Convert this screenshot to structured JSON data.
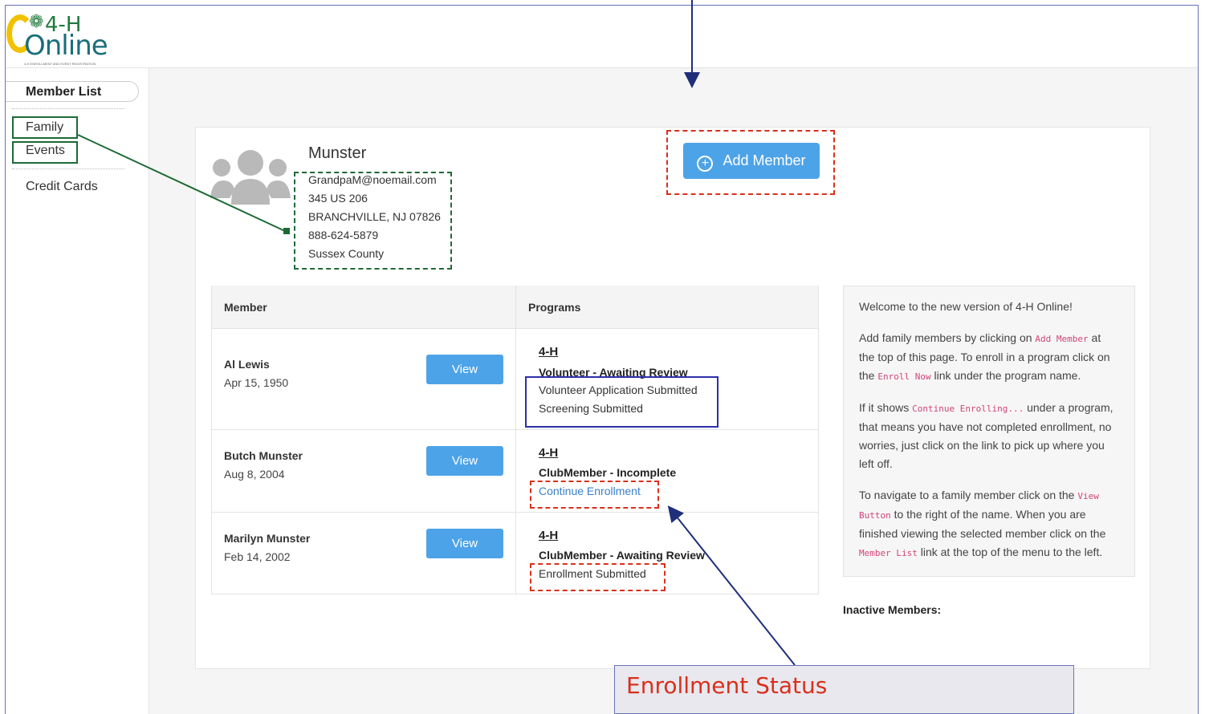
{
  "logo": {
    "brand_top": "4-H",
    "brand_bottom": "Online",
    "tagline": "4-H ENROLLMENT AND EVENT REGISTRATION"
  },
  "sidebar": {
    "items": [
      {
        "label": "Member List"
      },
      {
        "label": "Family"
      },
      {
        "label": "Events"
      },
      {
        "label": "Credit Cards"
      }
    ]
  },
  "family": {
    "name": "Munster",
    "email": "GrandpaM@noemail.com",
    "street": "345 US 206",
    "city": "BRANCHVILLE, NJ 07826",
    "phone": "888-624-5879",
    "county": "Sussex County"
  },
  "add_member_label": "Add Member",
  "table": {
    "headers": [
      "Member",
      "Programs"
    ],
    "view_label": "View",
    "rows": [
      {
        "name": "Al Lewis",
        "dob": "Apr 15, 1950",
        "program": "4-H",
        "role": "Volunteer - Awaiting Review",
        "status": [
          "Volunteer Application Submitted",
          "Screening Submitted"
        ]
      },
      {
        "name": "Butch Munster",
        "dob": "Aug 8, 2004",
        "program": "4-H",
        "role": "ClubMember - Incomplete",
        "status": [
          "Continue Enrollment"
        ]
      },
      {
        "name": "Marilyn Munster",
        "dob": "Feb 14, 2002",
        "program": "4-H",
        "role": "ClubMember - Awaiting Review",
        "status": [
          "Enrollment Submitted"
        ]
      }
    ]
  },
  "info": {
    "welcome": "Welcome to the new version of 4-H Online!",
    "p1_a": "Add family members by clicking on ",
    "p1_code1": "Add Member",
    "p1_b": " at the top of this page. To enroll in a program click on the ",
    "p1_code2": "Enroll Now",
    "p1_c": " link under the program name.",
    "p2_a": "If it shows ",
    "p2_code": "Continue Enrolling...",
    "p2_b": " under a program, that means you have not completed enrollment, no worries, just click on the link to pick up where you left off.",
    "p3_a": "To navigate to a family member click on the ",
    "p3_code1": "View Button",
    "p3_b": " to the right of the name. When you are finished viewing the selected member click on the ",
    "p3_code2": "Member List",
    "p3_c": " link at the top of the menu to the left."
  },
  "inactive_label": "Inactive Members:",
  "callout": {
    "label": "Enrollment Status"
  },
  "colors": {
    "accent": "#4da3e8",
    "annotation_red": "#d9301c",
    "annotation_green": "#1e6a35",
    "annotation_blue": "#2e2fa8"
  }
}
